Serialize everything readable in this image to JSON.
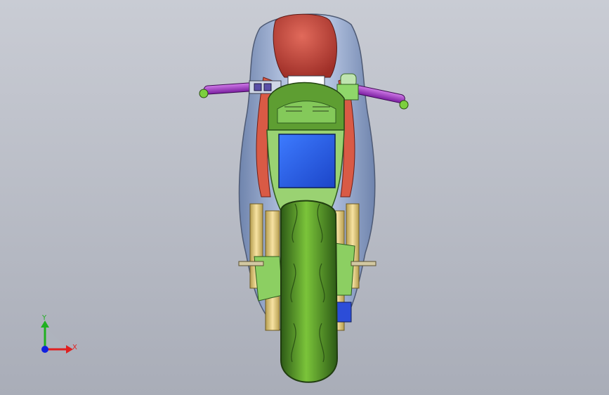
{
  "viewport": {
    "subject": "motorcycle-front-view-model",
    "background_top": "#c9ccd4",
    "background_bottom": "#a9adb8"
  },
  "triad": {
    "x_label": "X",
    "y_label": "Y",
    "x_color": "#e02020",
    "y_color": "#20b020",
    "z_color": "#1020e0"
  },
  "colors": {
    "fairing": "#a7b7d4",
    "fuel_tank": "#c84a3e",
    "frame": "#e0603e",
    "grips": "#a030c8",
    "plate": "#2a63e8",
    "tire": "#5ea02a",
    "fork": "#f2d98a",
    "green_parts": "#7acb52"
  }
}
